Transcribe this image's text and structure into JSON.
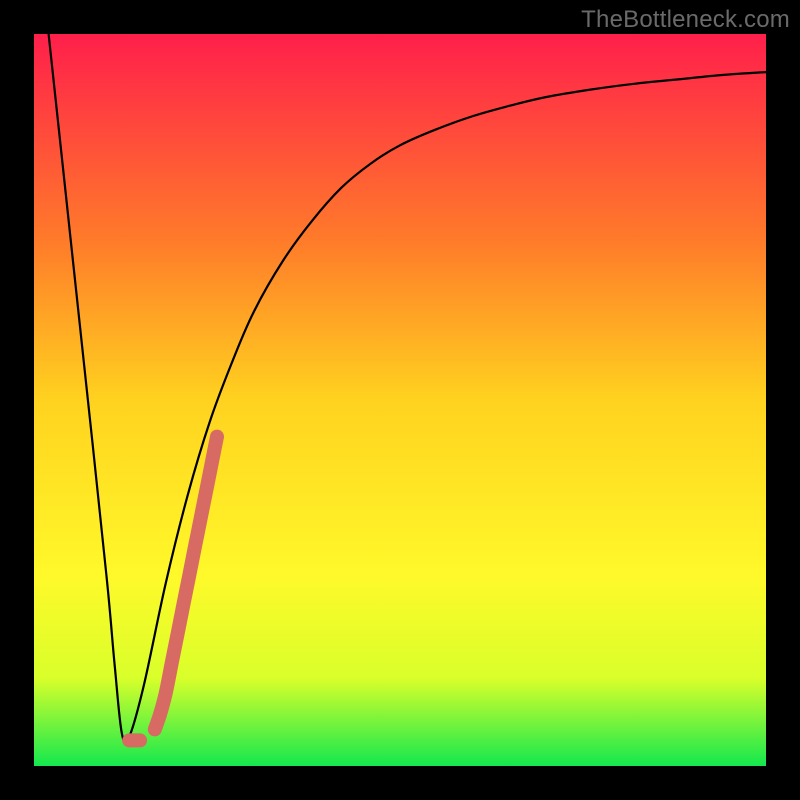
{
  "watermark": "TheBottleneck.com",
  "colors": {
    "frame": "#000000",
    "gradient_top": "#ff1f4b",
    "gradient_mid_upper": "#ff7a2a",
    "gradient_mid": "#ffd21f",
    "gradient_mid_lower": "#fff92a",
    "gradient_lower": "#d9ff2a",
    "gradient_bottom": "#14e84e",
    "curve": "#000000",
    "highlight": "#d86a64"
  },
  "chart_data": {
    "type": "line",
    "title": "",
    "xlabel": "",
    "ylabel": "",
    "xlim": [
      0,
      100
    ],
    "ylim": [
      0,
      100
    ],
    "annotations": [],
    "series": [
      {
        "name": "bottleneck-curve",
        "x": [
          2.0,
          5.0,
          8.0,
          10.0,
          11.0,
          12.0,
          13.0,
          15.0,
          18.0,
          21.0,
          24.0,
          27.0,
          30.0,
          34.0,
          38.0,
          42.0,
          46.0,
          50.0,
          55.0,
          60.0,
          65.0,
          70.0,
          76.0,
          82.0,
          88.0,
          94.0,
          100.0
        ],
        "y": [
          100.0,
          72.0,
          44.0,
          25.0,
          14.0,
          4.5,
          4.0,
          11.0,
          25.0,
          37.0,
          47.0,
          55.0,
          62.0,
          69.0,
          74.5,
          79.0,
          82.3,
          84.8,
          87.0,
          88.8,
          90.2,
          91.4,
          92.4,
          93.2,
          93.8,
          94.4,
          94.8
        ]
      },
      {
        "name": "highlight-segment",
        "x": [
          16.5,
          17.2,
          18.0,
          18.8,
          19.6,
          20.4,
          21.2,
          22.0,
          22.8,
          23.6,
          24.4,
          25.0
        ],
        "y": [
          5.0,
          7.0,
          10.0,
          14.0,
          18.0,
          22.0,
          26.0,
          30.0,
          34.0,
          38.0,
          42.0,
          45.0
        ]
      },
      {
        "name": "bottom-dot",
        "x": [
          13.0,
          14.5
        ],
        "y": [
          3.5,
          3.5
        ]
      }
    ]
  }
}
